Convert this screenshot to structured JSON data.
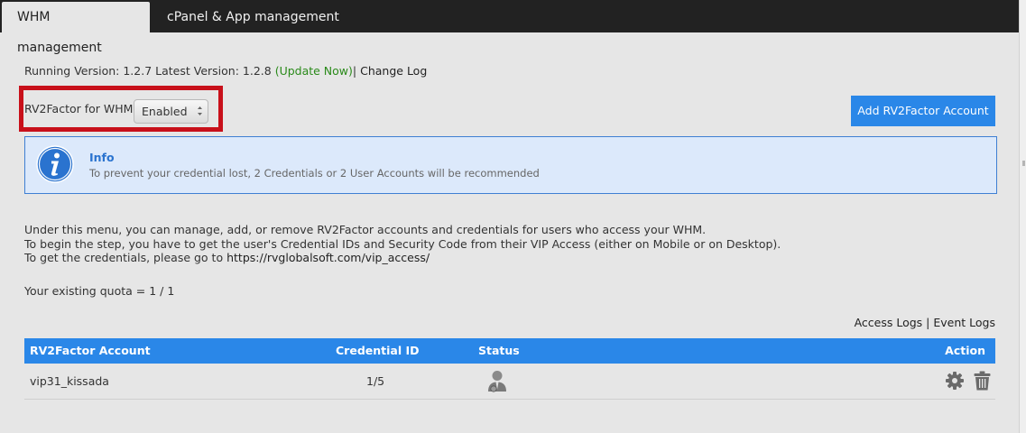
{
  "tabs": [
    {
      "label": "WHM management",
      "active": true
    },
    {
      "label": "cPanel & App management",
      "active": false
    }
  ],
  "version": {
    "running_label": "Running Version: 1.2.7",
    "latest_label": "Latest Version: 1.2.8",
    "update_link": "(Update Now)",
    "separator": "|",
    "changelog_link": "Change Log"
  },
  "rv2factor": {
    "label": "RV2Factor for WHM:",
    "selected": "Enabled"
  },
  "add_button": "Add RV2Factor Account",
  "info": {
    "title": "Info",
    "text": "To prevent your credential lost, 2 Credentials or 2 User Accounts will be recommended"
  },
  "description": {
    "line1": "Under this menu, you can manage, add, or remove RV2Factor accounts and credentials for users who access your WHM.",
    "line2": "To begin the step, you have to get the user's Credential IDs and Security Code from their VIP Access (either on Mobile or on Desktop).",
    "line3_prefix": "To get the credentials, please go to",
    "line3_link": "https://rvglobalsoft.com/vip_access/"
  },
  "quota": "Your existing quota = 1 / 1",
  "logs": {
    "access": "Access Logs",
    "separator": "|",
    "event": "Event Logs"
  },
  "table": {
    "headers": {
      "account": "RV2Factor Account",
      "credential": "Credential ID",
      "status": "Status",
      "action": "Action"
    },
    "rows": [
      {
        "account": "vip31_kissada",
        "credential": "1/5",
        "status_icon": "user-status-icon"
      }
    ]
  },
  "colors": {
    "accent": "#2a87e8",
    "highlight": "#c8101a",
    "update_link": "#2a8a1a",
    "info_bg": "#dce9fb"
  }
}
